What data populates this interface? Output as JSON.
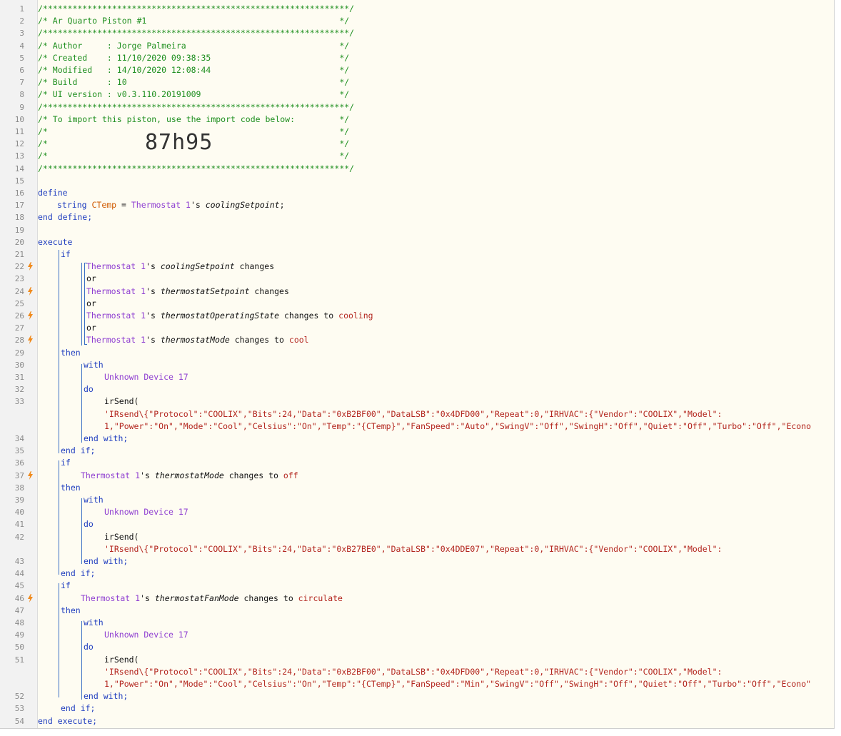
{
  "import_code": "87h95",
  "lines": [
    {
      "n": "1",
      "t": [
        {
          "c": "cm",
          "v": "/**************************************************************/"
        }
      ]
    },
    {
      "n": "2",
      "t": [
        {
          "c": "cm",
          "v": "/* Ar Quarto Piston #1                                       */"
        }
      ]
    },
    {
      "n": "3",
      "t": [
        {
          "c": "cm",
          "v": "/**************************************************************/"
        }
      ]
    },
    {
      "n": "4",
      "t": [
        {
          "c": "cm",
          "v": "/* Author     : Jorge Palmeira                               */"
        }
      ]
    },
    {
      "n": "5",
      "t": [
        {
          "c": "cm",
          "v": "/* Created    : 11/10/2020 09:38:35                          */"
        }
      ]
    },
    {
      "n": "6",
      "t": [
        {
          "c": "cm",
          "v": "/* Modified   : 14/10/2020 12:08:44                          */"
        }
      ]
    },
    {
      "n": "7",
      "t": [
        {
          "c": "cm",
          "v": "/* Build      : 10                                           */"
        }
      ]
    },
    {
      "n": "8",
      "t": [
        {
          "c": "cm",
          "v": "/* UI version : v0.3.110.20191009                            */"
        }
      ]
    },
    {
      "n": "9",
      "t": [
        {
          "c": "cm",
          "v": "/**************************************************************/"
        }
      ]
    },
    {
      "n": "10",
      "t": [
        {
          "c": "cm",
          "v": "/* To import this piston, use the import code below:         */"
        }
      ]
    },
    {
      "n": "11",
      "t": [
        {
          "c": "cm",
          "v": "/*                                                           */"
        }
      ]
    },
    {
      "n": "12",
      "t": [
        {
          "c": "cm",
          "v": "/*                                                           */"
        }
      ]
    },
    {
      "n": "13",
      "t": [
        {
          "c": "cm",
          "v": "/*                                                           */"
        }
      ]
    },
    {
      "n": "14",
      "t": [
        {
          "c": "cm",
          "v": "/**************************************************************/"
        }
      ]
    },
    {
      "n": "15",
      "t": []
    },
    {
      "n": "16",
      "t": [
        {
          "c": "kw",
          "v": "define"
        }
      ]
    },
    {
      "n": "17",
      "i": 28,
      "t": [
        {
          "c": "kw",
          "v": "string "
        },
        {
          "c": "var",
          "v": "CTemp"
        },
        {
          "c": "plain",
          "v": " = "
        },
        {
          "c": "dev",
          "v": "Thermostat 1"
        },
        {
          "c": "plain",
          "v": "'s "
        },
        {
          "c": "attr",
          "v": "coolingSetpoint"
        },
        {
          "c": "plain",
          "v": ";"
        }
      ]
    },
    {
      "n": "18",
      "t": [
        {
          "c": "kw",
          "v": "end define;"
        }
      ]
    },
    {
      "n": "19",
      "t": []
    },
    {
      "n": "20",
      "t": [
        {
          "c": "kw",
          "v": "execute"
        }
      ]
    },
    {
      "n": "21",
      "i": 33,
      "t": [
        {
          "c": "kw",
          "v": "if"
        }
      ]
    },
    {
      "n": "22",
      "i": 69,
      "trig": true,
      "t": [
        {
          "c": "dev",
          "v": "Thermostat 1"
        },
        {
          "c": "plain",
          "v": "'s "
        },
        {
          "c": "attr",
          "v": "coolingSetpoint"
        },
        {
          "c": "plain",
          "v": " changes"
        }
      ]
    },
    {
      "n": "23",
      "i": 69,
      "t": [
        {
          "c": "plain",
          "v": "or"
        }
      ]
    },
    {
      "n": "24",
      "i": 69,
      "trig": true,
      "t": [
        {
          "c": "dev",
          "v": "Thermostat 1"
        },
        {
          "c": "plain",
          "v": "'s "
        },
        {
          "c": "attr",
          "v": "thermostatSetpoint"
        },
        {
          "c": "plain",
          "v": " changes"
        }
      ]
    },
    {
      "n": "25",
      "i": 69,
      "t": [
        {
          "c": "plain",
          "v": "or"
        }
      ]
    },
    {
      "n": "26",
      "i": 69,
      "trig": true,
      "t": [
        {
          "c": "dev",
          "v": "Thermostat 1"
        },
        {
          "c": "plain",
          "v": "'s "
        },
        {
          "c": "attr",
          "v": "thermostatOperatingState"
        },
        {
          "c": "plain",
          "v": " changes to "
        },
        {
          "c": "val",
          "v": "cooling"
        }
      ]
    },
    {
      "n": "27",
      "i": 69,
      "t": [
        {
          "c": "plain",
          "v": "or"
        }
      ]
    },
    {
      "n": "28",
      "i": 69,
      "trig": true,
      "t": [
        {
          "c": "dev",
          "v": "Thermostat 1"
        },
        {
          "c": "plain",
          "v": "'s "
        },
        {
          "c": "attr",
          "v": "thermostatMode"
        },
        {
          "c": "plain",
          "v": " changes to "
        },
        {
          "c": "val",
          "v": "cool"
        }
      ]
    },
    {
      "n": "29",
      "i": 33,
      "t": [
        {
          "c": "kw",
          "v": "then"
        }
      ]
    },
    {
      "n": "30",
      "i": 65,
      "t": [
        {
          "c": "kw",
          "v": "with"
        }
      ]
    },
    {
      "n": "31",
      "i": 94,
      "t": [
        {
          "c": "dev",
          "v": "Unknown Device 17"
        }
      ]
    },
    {
      "n": "32",
      "i": 65,
      "t": [
        {
          "c": "kw",
          "v": "do"
        }
      ]
    },
    {
      "n": "33",
      "i": 94,
      "t": [
        {
          "c": "plain",
          "v": "irSend("
        }
      ]
    },
    {
      "n": "",
      "i": 94,
      "t": [
        {
          "c": "str",
          "v": "'IRsend\\{\"Protocol\":\"COOLIX\",\"Bits\":24,\"Data\":\"0xB2BF00\",\"DataLSB\":\"0x4DFD00\",\"Repeat\":0,\"IRHVAC\":{\"Vendor\":\"COOLIX\",\"Model\":"
        }
      ]
    },
    {
      "n": "",
      "i": 94,
      "t": [
        {
          "c": "str",
          "v": "1,\"Power\":\"On\",\"Mode\":\"Cool\",\"Celsius\":\"On\",\"Temp\":\"{CTemp}\",\"FanSpeed\":\"Auto\",\"SwingV\":\"Off\",\"SwingH\":\"Off\",\"Quiet\":\"Off\",\"Turbo\":\"Off\",\"Econo"
        }
      ]
    },
    {
      "n": "34",
      "i": 65,
      "t": [
        {
          "c": "kw",
          "v": "end with;"
        }
      ]
    },
    {
      "n": "35",
      "i": 33,
      "t": [
        {
          "c": "kw",
          "v": "end if;"
        }
      ]
    },
    {
      "n": "36",
      "i": 33,
      "t": [
        {
          "c": "kw",
          "v": "if"
        }
      ]
    },
    {
      "n": "37",
      "i": 61,
      "trig": true,
      "t": [
        {
          "c": "dev",
          "v": "Thermostat 1"
        },
        {
          "c": "plain",
          "v": "'s "
        },
        {
          "c": "attr",
          "v": "thermostatMode"
        },
        {
          "c": "plain",
          "v": " changes to "
        },
        {
          "c": "val",
          "v": "off"
        }
      ]
    },
    {
      "n": "38",
      "i": 33,
      "t": [
        {
          "c": "kw",
          "v": "then"
        }
      ]
    },
    {
      "n": "39",
      "i": 65,
      "t": [
        {
          "c": "kw",
          "v": "with"
        }
      ]
    },
    {
      "n": "40",
      "i": 94,
      "t": [
        {
          "c": "dev",
          "v": "Unknown Device 17"
        }
      ]
    },
    {
      "n": "41",
      "i": 65,
      "t": [
        {
          "c": "kw",
          "v": "do"
        }
      ]
    },
    {
      "n": "42",
      "i": 94,
      "t": [
        {
          "c": "plain",
          "v": "irSend("
        }
      ]
    },
    {
      "n": "",
      "i": 94,
      "t": [
        {
          "c": "str",
          "v": "'IRsend\\{\"Protocol\":\"COOLIX\",\"Bits\":24,\"Data\":\"0xB27BE0\",\"DataLSB\":\"0x4DDE07\",\"Repeat\":0,\"IRHVAC\":{\"Vendor\":\"COOLIX\",\"Model\":"
        }
      ]
    },
    {
      "n": "43",
      "i": 65,
      "t": [
        {
          "c": "kw",
          "v": "end with;"
        }
      ]
    },
    {
      "n": "44",
      "i": 33,
      "t": [
        {
          "c": "kw",
          "v": "end if;"
        }
      ]
    },
    {
      "n": "45",
      "i": 33,
      "t": [
        {
          "c": "kw",
          "v": "if"
        }
      ]
    },
    {
      "n": "46",
      "i": 61,
      "trig": true,
      "t": [
        {
          "c": "dev",
          "v": "Thermostat 1"
        },
        {
          "c": "plain",
          "v": "'s "
        },
        {
          "c": "attr",
          "v": "thermostatFanMode"
        },
        {
          "c": "plain",
          "v": " changes to "
        },
        {
          "c": "val",
          "v": "circulate"
        }
      ]
    },
    {
      "n": "47",
      "i": 33,
      "t": [
        {
          "c": "kw",
          "v": "then"
        }
      ]
    },
    {
      "n": "48",
      "i": 65,
      "t": [
        {
          "c": "kw",
          "v": "with"
        }
      ]
    },
    {
      "n": "49",
      "i": 94,
      "t": [
        {
          "c": "dev",
          "v": "Unknown Device 17"
        }
      ]
    },
    {
      "n": "50",
      "i": 65,
      "t": [
        {
          "c": "kw",
          "v": "do"
        }
      ]
    },
    {
      "n": "51",
      "i": 94,
      "t": [
        {
          "c": "plain",
          "v": "irSend("
        }
      ]
    },
    {
      "n": "",
      "i": 94,
      "t": [
        {
          "c": "str",
          "v": "'IRsend\\{\"Protocol\":\"COOLIX\",\"Bits\":24,\"Data\":\"0xB2BF00\",\"DataLSB\":\"0x4DFD00\",\"Repeat\":0,\"IRHVAC\":{\"Vendor\":\"COOLIX\",\"Model\":"
        }
      ]
    },
    {
      "n": "",
      "i": 94,
      "t": [
        {
          "c": "str",
          "v": "1,\"Power\":\"On\",\"Mode\":\"Cool\",\"Celsius\":\"On\",\"Temp\":\"{CTemp}\",\"FanSpeed\":\"Min\",\"SwingV\":\"Off\",\"SwingH\":\"Off\",\"Quiet\":\"Off\",\"Turbo\":\"Off\",\"Econo\""
        }
      ]
    },
    {
      "n": "52",
      "i": 65,
      "t": [
        {
          "c": "kw",
          "v": "end with;"
        }
      ]
    },
    {
      "n": "53",
      "i": 33,
      "t": [
        {
          "c": "kw",
          "v": "end if;"
        }
      ]
    },
    {
      "n": "54",
      "t": [
        {
          "c": "kw",
          "v": "end execute;"
        }
      ]
    }
  ]
}
